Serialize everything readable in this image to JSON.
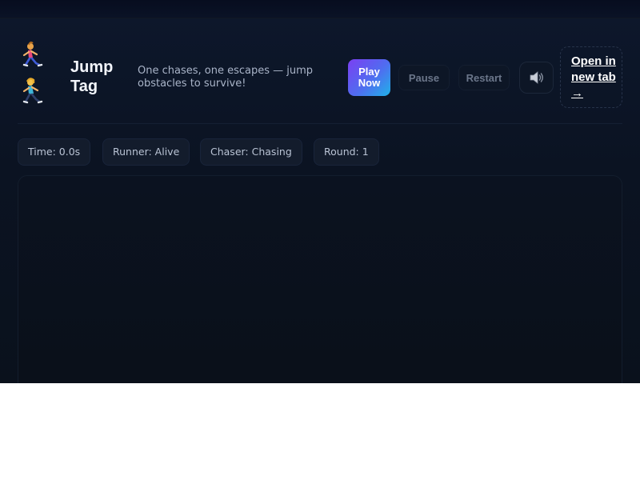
{
  "app": {
    "title": "Jump Tag",
    "subtitle": "One chases, one escapes — jump obstacles to survive!"
  },
  "logo": {
    "icons": [
      "runner-icon",
      "runner-icon"
    ]
  },
  "toolbar": {
    "play_label": "Play Now",
    "pause_label": "Pause",
    "restart_label": "Restart",
    "sound_icon": "speaker-icon",
    "open_label": "Open in new tab →"
  },
  "stats": {
    "time": "Time: 0.0s",
    "runner": "Runner: Alive",
    "chaser": "Chaser: Chasing",
    "round": "Round: 1"
  },
  "colors": {
    "background": "#0b1322",
    "accent_start": "#7b3ff2",
    "accent_end": "#1fb2e8",
    "pill_bg": "#131c2c"
  }
}
